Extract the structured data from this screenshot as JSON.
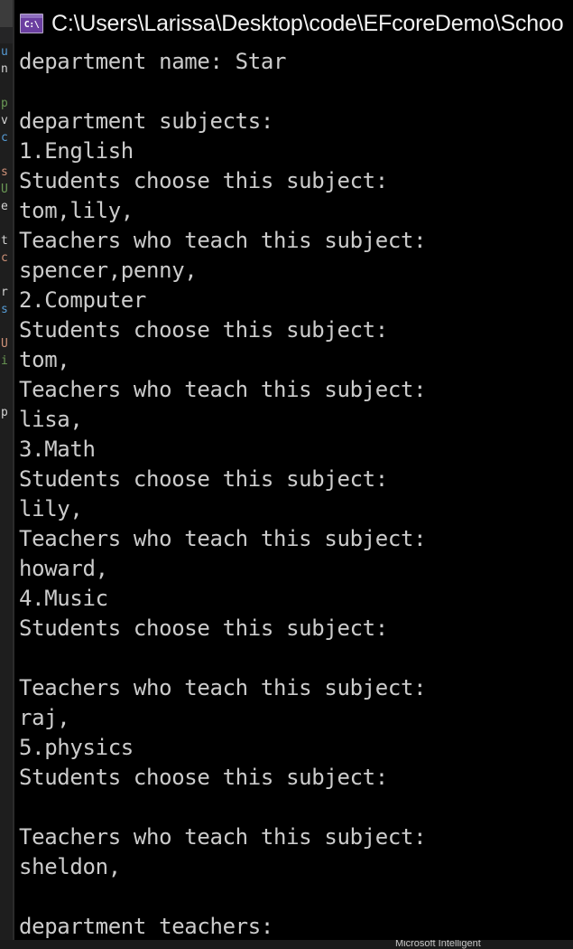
{
  "window": {
    "title": "C:\\Users\\Larissa\\Desktop\\code\\EFcoreDemo\\Schoo",
    "icon_name": "console-app-icon",
    "icon_glyph": "C:\\",
    "background_color": "#000000",
    "text_color": "#cccccc"
  },
  "console": {
    "lines": [
      "department name: Star",
      "",
      "department subjects:",
      "1.English",
      "Students choose this subject:",
      "tom,lily,",
      "Teachers who teach this subject:",
      "spencer,penny,",
      "2.Computer",
      "Students choose this subject:",
      "tom,",
      "Teachers who teach this subject:",
      "lisa,",
      "3.Math",
      "Students choose this subject:",
      "lily,",
      "Teachers who teach this subject:",
      "howard,",
      "4.Music",
      "Students choose this subject:",
      "",
      "Teachers who teach this subject:",
      "raj,",
      "5.physics",
      "Students choose this subject:",
      "",
      "Teachers who teach this subject:",
      "sheldon,",
      "",
      "department teachers:"
    ]
  },
  "background_editor": {
    "code_lines": [
      "u",
      "n",
      "",
      "p",
      "v",
      "c",
      "",
      "s",
      "U",
      "e",
      "",
      "t",
      "c",
      "",
      "r",
      "s",
      "",
      "U",
      "i",
      "",
      "",
      "p",
      "",
      "",
      "",
      "",
      "",
      "",
      "",
      "",
      "",
      "",
      "",
      "",
      "",
      "",
      "",
      "",
      "",
      "",
      "",
      "",
      "",
      "",
      "",
      "",
      "",
      "",
      "",
      "",
      "",
      "",
      ""
    ]
  },
  "taskbar": {
    "label": "Microsoft Intelligent"
  }
}
